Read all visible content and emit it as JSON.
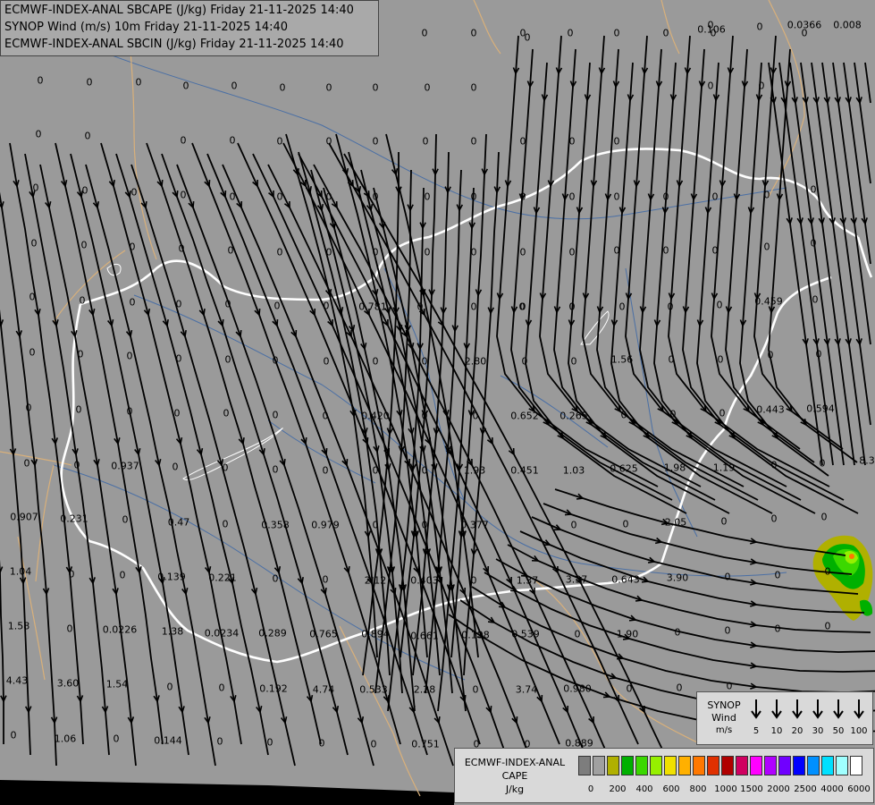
{
  "header": {
    "line1": "ECMWF-INDEX-ANAL SBCAPE (J/kg) Friday 21-11-2025 14:40",
    "line2": "SYNOP Wind (m/s) 10m Friday 21-11-2025 14:40",
    "line3": "ECMWF-INDEX-ANAL SBCIN (J/kg) Friday 21-11-2025 14:40"
  },
  "cape_values": [
    "0",
    "0",
    "0",
    "0",
    "0",
    "0",
    "0",
    "0",
    "0",
    "0",
    "0",
    "0",
    "0",
    "0.106",
    "0",
    "0.0366",
    "0.008",
    "0",
    "0",
    "0",
    "0",
    "0",
    "0",
    "0",
    "0",
    "0",
    "0",
    "0",
    "0",
    "0",
    "0",
    "0",
    "0",
    "0",
    "0",
    "0",
    "0",
    "0",
    "0",
    "0",
    "0",
    "0.781",
    "0",
    "0",
    "0",
    "0",
    "0.459",
    "2.80",
    "1.56",
    "0",
    "0",
    "0.420",
    "0.652",
    "0.265",
    "0.443",
    "0.594",
    "0.937",
    "1.93",
    "0.451",
    "1.03",
    "0.625",
    "1.98",
    "1.19",
    "0.907",
    "0.231",
    "0.47",
    "0.358",
    "0.979",
    "0.377",
    "2.05",
    "1.04",
    "0.139",
    "0.221",
    "2.12",
    "0.403",
    "1.37",
    "3.37",
    "0.643",
    "3.90",
    "1.58",
    "0.0226",
    "1.38",
    "0.0234",
    "0.289",
    "0.765",
    "0.894",
    "0.661",
    "0.198",
    "0.539",
    "1.90",
    "4.43",
    "3.60",
    "1.54",
    "0.192",
    "4.74",
    "0.533",
    "2.28",
    "3.74",
    "0.980",
    "1.06",
    "0.144",
    "0.751",
    "0.889",
    "8.3"
  ],
  "wind_legend": {
    "title_lines": [
      "SYNOP",
      "Wind",
      "m/s"
    ],
    "speeds": [
      "5",
      "10",
      "20",
      "30",
      "50",
      "100"
    ]
  },
  "cape_legend": {
    "title_lines": [
      "ECMWF-INDEX-ANAL",
      "CAPE",
      "J/kg"
    ],
    "ticks": [
      "0",
      "200",
      "400",
      "600",
      "800",
      "1000",
      "1500",
      "2000",
      "2500",
      "4000",
      "6000"
    ],
    "colors": [
      "#7d7d7d",
      "#a0a0a0",
      "#b0b000",
      "#00b000",
      "#3bd800",
      "#96f000",
      "#f0e000",
      "#ffb000",
      "#ff7800",
      "#e03000",
      "#b00000",
      "#d00060",
      "#ff00ff",
      "#b000ff",
      "#7000ff",
      "#0000ff",
      "#0090ff",
      "#00e0ff",
      "#a0ffff",
      "#ffffff"
    ]
  },
  "colors": {
    "background": "#9a9a9a",
    "border_country": "#ffffff",
    "border_region": "#d9b07a",
    "rivers": "#4a6fa5",
    "streamlines": "#000000"
  }
}
